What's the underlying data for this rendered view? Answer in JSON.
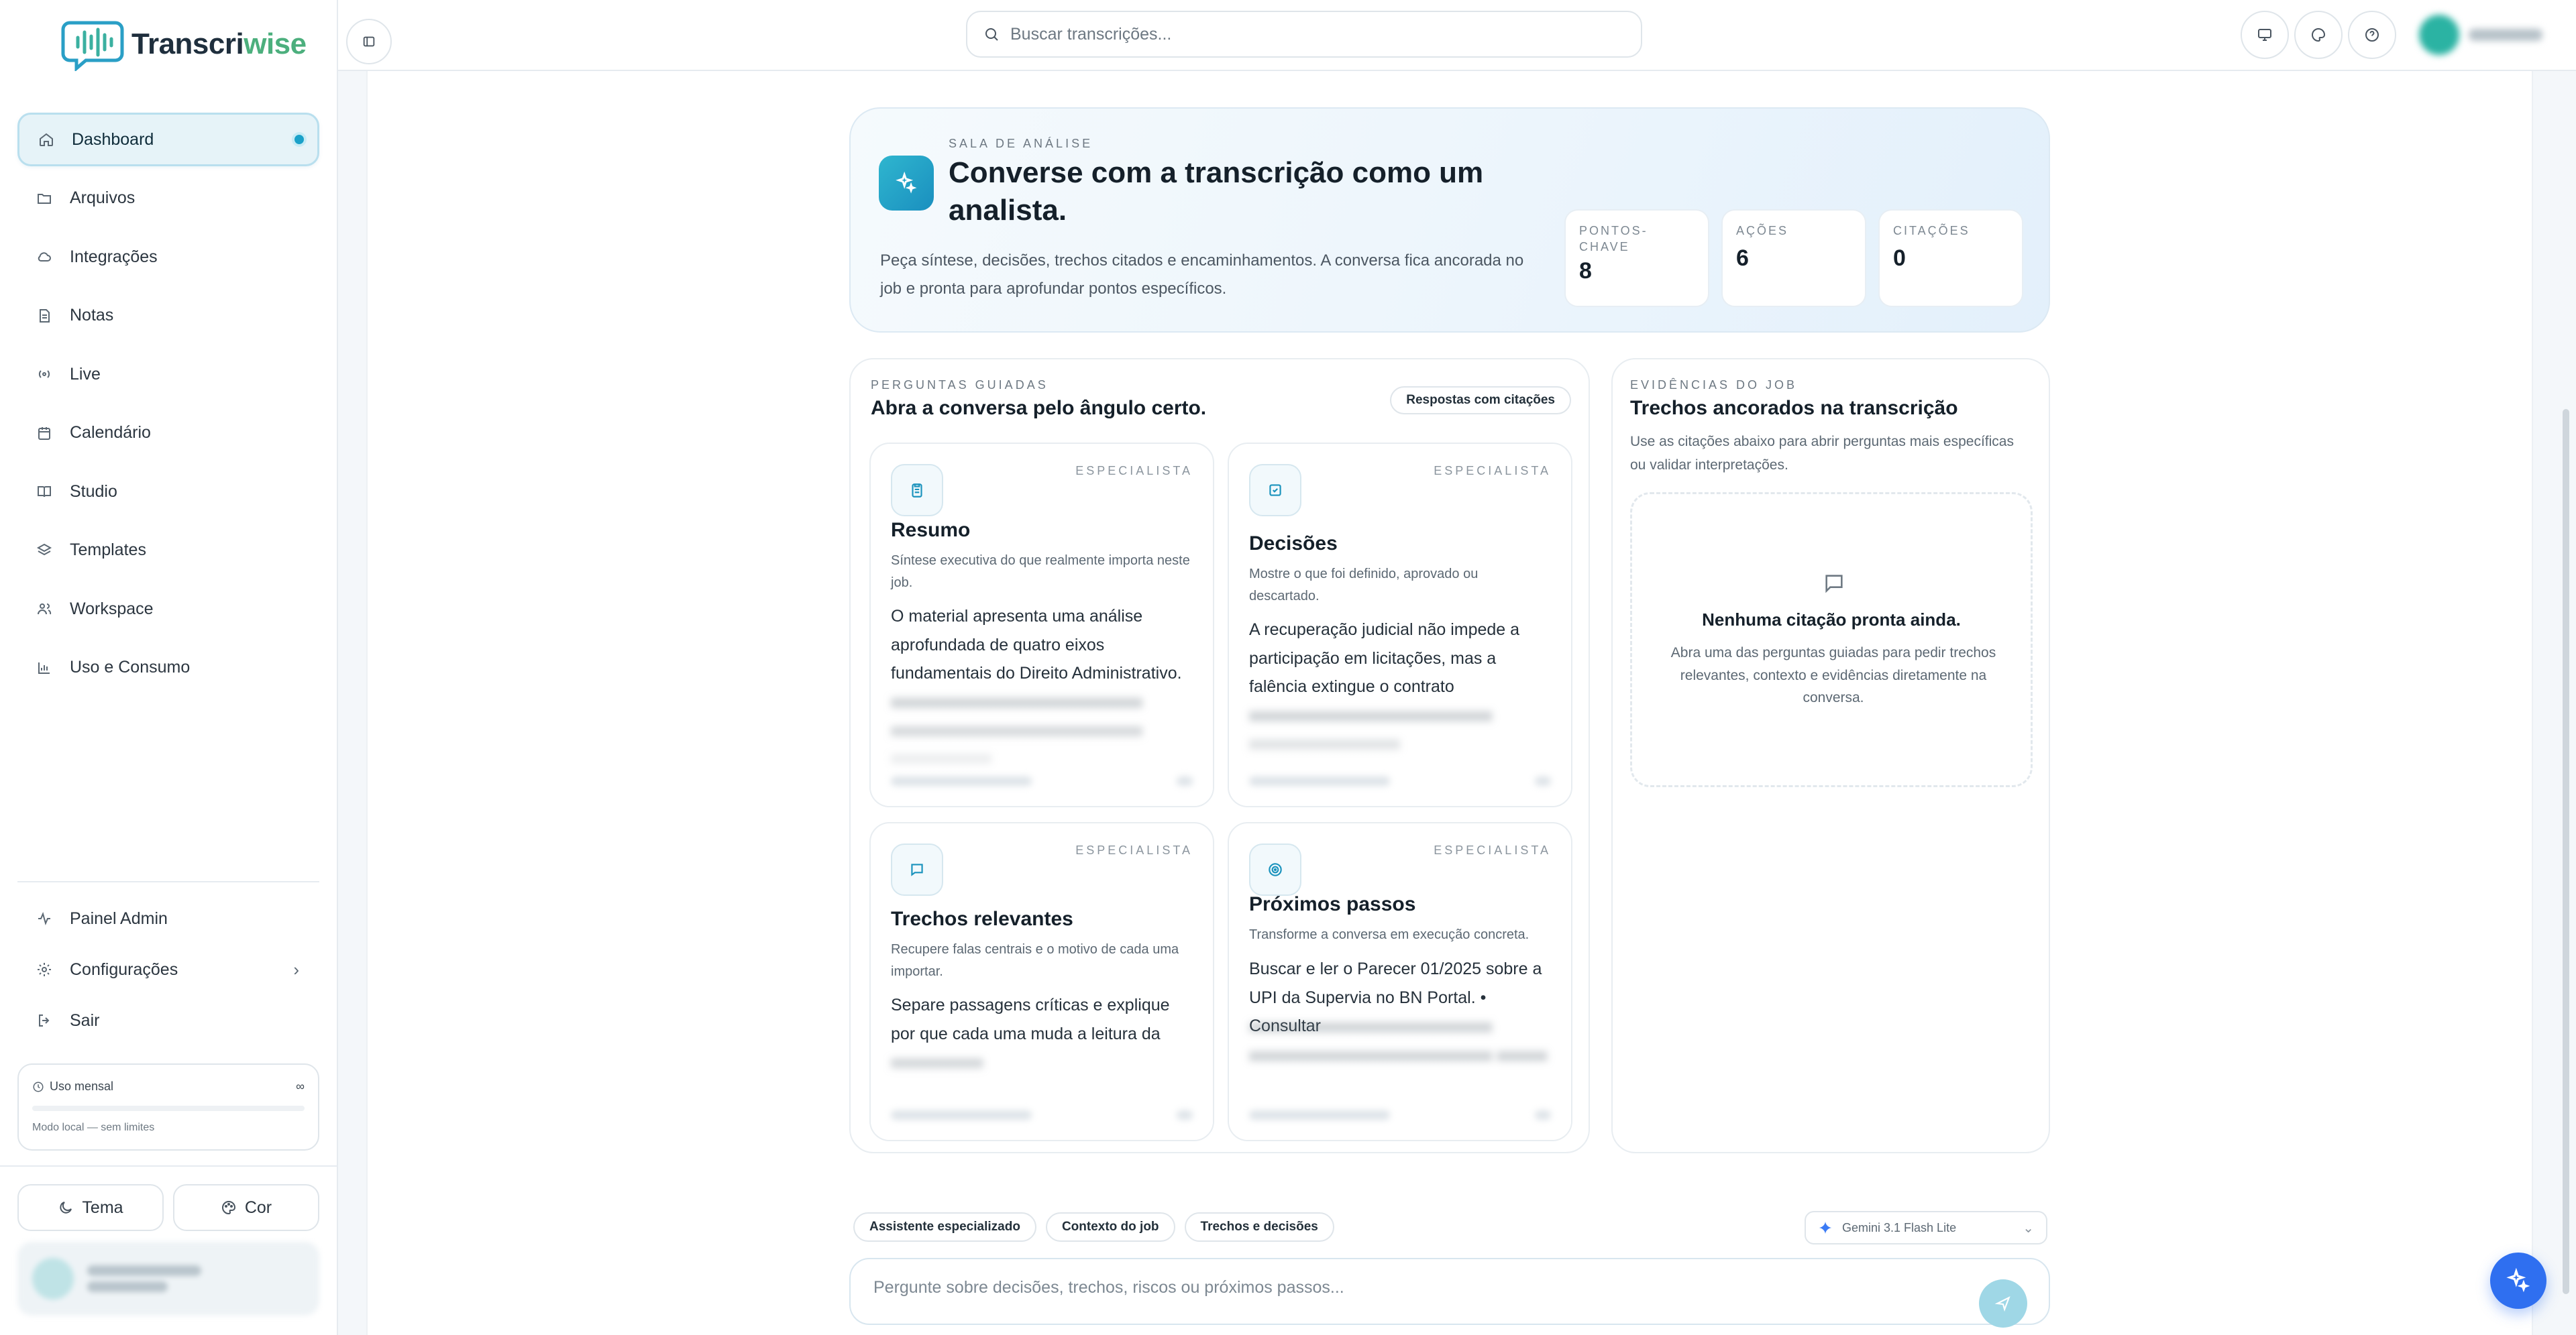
{
  "app": {
    "name_part1": "Transcri",
    "name_part2": "wise"
  },
  "sidebar": {
    "items": [
      {
        "label": "Dashboard",
        "icon": "home-icon",
        "active": true
      },
      {
        "label": "Arquivos",
        "icon": "folder-icon"
      },
      {
        "label": "Integrações",
        "icon": "cloud-icon"
      },
      {
        "label": "Notas",
        "icon": "note-icon"
      },
      {
        "label": "Live",
        "icon": "broadcast-icon"
      },
      {
        "label": "Calendário",
        "icon": "calendar-icon"
      },
      {
        "label": "Studio",
        "icon": "book-icon"
      },
      {
        "label": "Templates",
        "icon": "layers-icon"
      },
      {
        "label": "Workspace",
        "icon": "users-icon"
      },
      {
        "label": "Uso e Consumo",
        "icon": "bar-chart-icon"
      }
    ],
    "bottom_items": [
      {
        "label": "Painel Admin",
        "icon": "activity-icon"
      },
      {
        "label": "Configurações",
        "icon": "gear-icon"
      },
      {
        "label": "Sair",
        "icon": "logout-icon"
      }
    ],
    "usage": {
      "title": "Uso mensal",
      "limit": "∞",
      "note": "Modo local — sem limites"
    },
    "theme_button": "Tema",
    "color_button": "Cor"
  },
  "topbar": {
    "search_placeholder": "Buscar transcrições..."
  },
  "hero": {
    "eyebrow": "SALA DE ANÁLISE",
    "title": "Converse com a transcrição como um analista.",
    "description": "Peça síntese, decisões, trechos citados e encaminhamentos. A conversa fica ancorada no job e pronta para aprofundar pontos específicos.",
    "stats": [
      {
        "label": "PONTOS-CHAVE",
        "value": "8"
      },
      {
        "label": "AÇÕES",
        "value": "6"
      },
      {
        "label": "CITAÇÕES",
        "value": "0"
      }
    ]
  },
  "guided": {
    "eyebrow": "PERGUNTAS GUIADAS",
    "title": "Abra a conversa pelo ângulo certo.",
    "chip": "Respostas com citações",
    "cards": [
      {
        "tag": "ESPECIALISTA",
        "title": "Resumo",
        "subtitle": "Síntese executiva do que realmente importa neste job.",
        "body": "O material apresenta uma análise aprofundada de quatro eixos fundamentais do Direito Administrativo.",
        "icon": "clipboard-icon"
      },
      {
        "tag": "ESPECIALISTA",
        "title": "Decisões",
        "subtitle": "Mostre o que foi definido, aprovado ou descartado.",
        "body": "A recuperação judicial não impede a participação em licitações, mas a falência extingue o contrato",
        "icon": "check-square-icon"
      },
      {
        "tag": "ESPECIALISTA",
        "title": "Trechos relevantes",
        "subtitle": "Recupere falas centrais e o motivo de cada uma importar.",
        "body": "Separe passagens críticas e explique por que cada uma muda a leitura da",
        "icon": "message-icon"
      },
      {
        "tag": "ESPECIALISTA",
        "title": "Próximos passos",
        "subtitle": "Transforme a conversa em execução concreta.",
        "body": "Buscar e ler o Parecer 01/2025 sobre a UPI da Supervia no BN Portal. • Consultar",
        "icon": "target-icon"
      }
    ]
  },
  "evidence": {
    "eyebrow": "EVIDÊNCIAS DO JOB",
    "title": "Trechos ancorados na transcrição",
    "description": "Use as citações abaixo para abrir perguntas mais específicas ou validar interpretações.",
    "empty_title": "Nenhuma citação pronta ainda.",
    "empty_description": "Abra uma das perguntas guiadas para pedir trechos relevantes, contexto e evidências diretamente na conversa."
  },
  "composer": {
    "chips": [
      "Assistente especializado",
      "Contexto do job",
      "Trechos e decisões"
    ],
    "model": "Gemini 3.1 Flash Lite",
    "placeholder": "Pergunte sobre decisões, trechos, riscos ou próximos passos..."
  },
  "colors": {
    "accent": "#1aa1c9",
    "brand_green": "#4caf7d",
    "fab": "#2f6ff0"
  }
}
